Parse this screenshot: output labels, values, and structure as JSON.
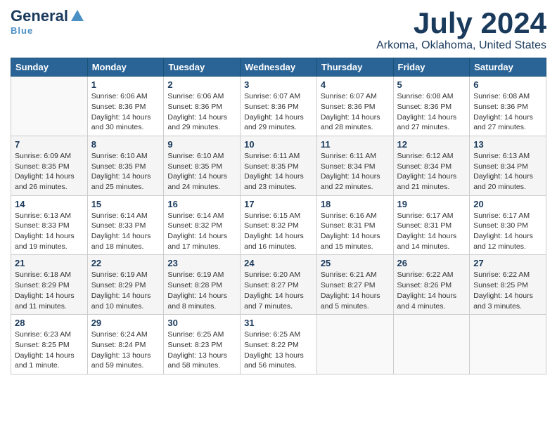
{
  "logo": {
    "general": "General",
    "blue": "Blue",
    "tagline": "Blue"
  },
  "title": {
    "month": "July 2024",
    "location": "Arkoma, Oklahoma, United States"
  },
  "headers": [
    "Sunday",
    "Monday",
    "Tuesday",
    "Wednesday",
    "Thursday",
    "Friday",
    "Saturday"
  ],
  "weeks": [
    [
      {
        "num": "",
        "info": ""
      },
      {
        "num": "1",
        "info": "Sunrise: 6:06 AM\nSunset: 8:36 PM\nDaylight: 14 hours\nand 30 minutes."
      },
      {
        "num": "2",
        "info": "Sunrise: 6:06 AM\nSunset: 8:36 PM\nDaylight: 14 hours\nand 29 minutes."
      },
      {
        "num": "3",
        "info": "Sunrise: 6:07 AM\nSunset: 8:36 PM\nDaylight: 14 hours\nand 29 minutes."
      },
      {
        "num": "4",
        "info": "Sunrise: 6:07 AM\nSunset: 8:36 PM\nDaylight: 14 hours\nand 28 minutes."
      },
      {
        "num": "5",
        "info": "Sunrise: 6:08 AM\nSunset: 8:36 PM\nDaylight: 14 hours\nand 27 minutes."
      },
      {
        "num": "6",
        "info": "Sunrise: 6:08 AM\nSunset: 8:36 PM\nDaylight: 14 hours\nand 27 minutes."
      }
    ],
    [
      {
        "num": "7",
        "info": "Sunrise: 6:09 AM\nSunset: 8:35 PM\nDaylight: 14 hours\nand 26 minutes."
      },
      {
        "num": "8",
        "info": "Sunrise: 6:10 AM\nSunset: 8:35 PM\nDaylight: 14 hours\nand 25 minutes."
      },
      {
        "num": "9",
        "info": "Sunrise: 6:10 AM\nSunset: 8:35 PM\nDaylight: 14 hours\nand 24 minutes."
      },
      {
        "num": "10",
        "info": "Sunrise: 6:11 AM\nSunset: 8:35 PM\nDaylight: 14 hours\nand 23 minutes."
      },
      {
        "num": "11",
        "info": "Sunrise: 6:11 AM\nSunset: 8:34 PM\nDaylight: 14 hours\nand 22 minutes."
      },
      {
        "num": "12",
        "info": "Sunrise: 6:12 AM\nSunset: 8:34 PM\nDaylight: 14 hours\nand 21 minutes."
      },
      {
        "num": "13",
        "info": "Sunrise: 6:13 AM\nSunset: 8:34 PM\nDaylight: 14 hours\nand 20 minutes."
      }
    ],
    [
      {
        "num": "14",
        "info": "Sunrise: 6:13 AM\nSunset: 8:33 PM\nDaylight: 14 hours\nand 19 minutes."
      },
      {
        "num": "15",
        "info": "Sunrise: 6:14 AM\nSunset: 8:33 PM\nDaylight: 14 hours\nand 18 minutes."
      },
      {
        "num": "16",
        "info": "Sunrise: 6:14 AM\nSunset: 8:32 PM\nDaylight: 14 hours\nand 17 minutes."
      },
      {
        "num": "17",
        "info": "Sunrise: 6:15 AM\nSunset: 8:32 PM\nDaylight: 14 hours\nand 16 minutes."
      },
      {
        "num": "18",
        "info": "Sunrise: 6:16 AM\nSunset: 8:31 PM\nDaylight: 14 hours\nand 15 minutes."
      },
      {
        "num": "19",
        "info": "Sunrise: 6:17 AM\nSunset: 8:31 PM\nDaylight: 14 hours\nand 14 minutes."
      },
      {
        "num": "20",
        "info": "Sunrise: 6:17 AM\nSunset: 8:30 PM\nDaylight: 14 hours\nand 12 minutes."
      }
    ],
    [
      {
        "num": "21",
        "info": "Sunrise: 6:18 AM\nSunset: 8:29 PM\nDaylight: 14 hours\nand 11 minutes."
      },
      {
        "num": "22",
        "info": "Sunrise: 6:19 AM\nSunset: 8:29 PM\nDaylight: 14 hours\nand 10 minutes."
      },
      {
        "num": "23",
        "info": "Sunrise: 6:19 AM\nSunset: 8:28 PM\nDaylight: 14 hours\nand 8 minutes."
      },
      {
        "num": "24",
        "info": "Sunrise: 6:20 AM\nSunset: 8:27 PM\nDaylight: 14 hours\nand 7 minutes."
      },
      {
        "num": "25",
        "info": "Sunrise: 6:21 AM\nSunset: 8:27 PM\nDaylight: 14 hours\nand 5 minutes."
      },
      {
        "num": "26",
        "info": "Sunrise: 6:22 AM\nSunset: 8:26 PM\nDaylight: 14 hours\nand 4 minutes."
      },
      {
        "num": "27",
        "info": "Sunrise: 6:22 AM\nSunset: 8:25 PM\nDaylight: 14 hours\nand 3 minutes."
      }
    ],
    [
      {
        "num": "28",
        "info": "Sunrise: 6:23 AM\nSunset: 8:25 PM\nDaylight: 14 hours\nand 1 minute."
      },
      {
        "num": "29",
        "info": "Sunrise: 6:24 AM\nSunset: 8:24 PM\nDaylight: 13 hours\nand 59 minutes."
      },
      {
        "num": "30",
        "info": "Sunrise: 6:25 AM\nSunset: 8:23 PM\nDaylight: 13 hours\nand 58 minutes."
      },
      {
        "num": "31",
        "info": "Sunrise: 6:25 AM\nSunset: 8:22 PM\nDaylight: 13 hours\nand 56 minutes."
      },
      {
        "num": "",
        "info": ""
      },
      {
        "num": "",
        "info": ""
      },
      {
        "num": "",
        "info": ""
      }
    ]
  ]
}
